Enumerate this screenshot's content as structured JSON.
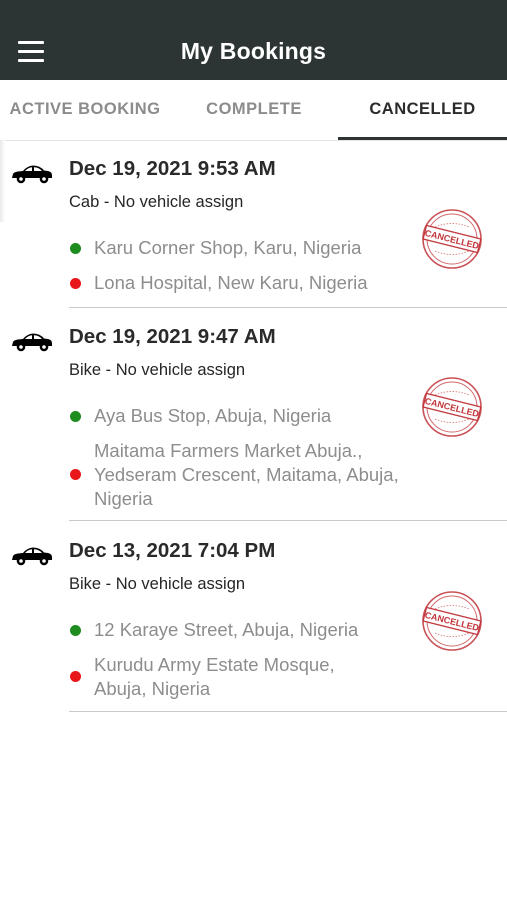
{
  "header": {
    "title": "My Bookings",
    "menu_icon": "hamburger-menu-icon",
    "background_color": "#2c3534"
  },
  "tabs": [
    {
      "label": "ACTIVE BOOKING",
      "selected": false
    },
    {
      "label": "COMPLETE",
      "selected": false
    },
    {
      "label": "CANCELLED",
      "selected": true
    }
  ],
  "bookings": [
    {
      "datetime": "Dec 19, 2021 9:53 AM",
      "vehicle": "Cab - No vehicle assign",
      "pickup": "Karu Corner Shop, Karu, Nigeria",
      "dropoff": "Lona Hospital, New Karu, Nigeria",
      "stamp_text": "CANCELLED",
      "vehicle_icon": "car-icon"
    },
    {
      "datetime": "Dec 19, 2021 9:47 AM",
      "vehicle": "Bike - No vehicle assign",
      "pickup": "Aya Bus Stop, Abuja, Nigeria",
      "dropoff": "Maitama Farmers Market Abuja., Yedseram Crescent, Maitama, Abuja, Nigeria",
      "stamp_text": "CANCELLED",
      "vehicle_icon": "car-icon"
    },
    {
      "datetime": "Dec 13, 2021 7:04 PM",
      "vehicle": "Bike - No vehicle assign",
      "pickup": "12 Karaye Street, Abuja, Nigeria",
      "dropoff": "Kurudu Army Estate Mosque, Abuja, Nigeria",
      "stamp_text": "CANCELLED",
      "vehicle_icon": "car-icon"
    }
  ],
  "colors": {
    "pickup_dot": "#1e8c1e",
    "dropoff_dot": "#e8171a",
    "stamp": "#c0343a"
  }
}
